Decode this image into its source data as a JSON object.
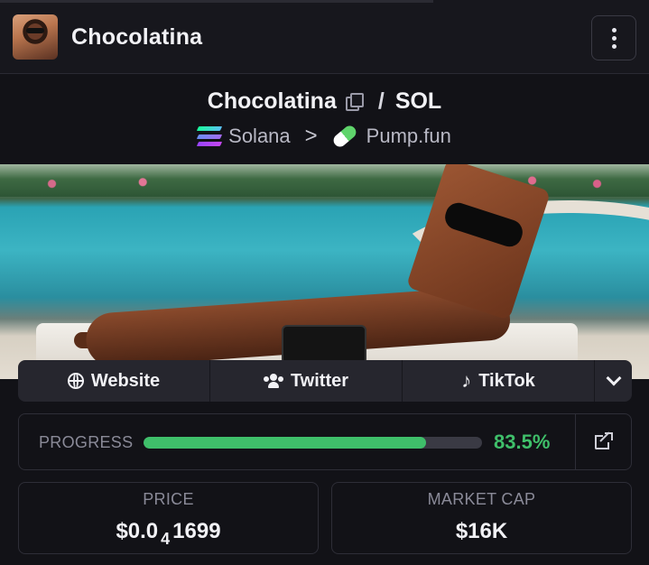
{
  "header": {
    "token_name": "Chocolatina"
  },
  "pair": {
    "base": "Chocolatina",
    "separator": "/",
    "quote": "SOL"
  },
  "chain": {
    "network": "Solana",
    "separator": ">",
    "dex": "Pump.fun"
  },
  "links": {
    "website": "Website",
    "twitter": "Twitter",
    "tiktok": "TikTok"
  },
  "progress": {
    "label": "PROGRESS",
    "value_text": "83.5%",
    "value": 83.5,
    "color": "#3fbf6a"
  },
  "stats": {
    "price": {
      "label": "PRICE",
      "value_prefix": "$0.0",
      "value_zeros": "4",
      "value_suffix": "1699"
    },
    "market_cap": {
      "label": "MARKET CAP",
      "value": "$16K"
    }
  },
  "icons": {
    "menu": "kebab-vertical-icon",
    "copy": "copy-icon",
    "chain": "solana-icon",
    "dex": "pill-icon",
    "website": "globe-icon",
    "twitter": "users-icon",
    "tiktok": "tiktok-icon",
    "more": "chevron-down-icon",
    "external": "external-link-icon"
  }
}
